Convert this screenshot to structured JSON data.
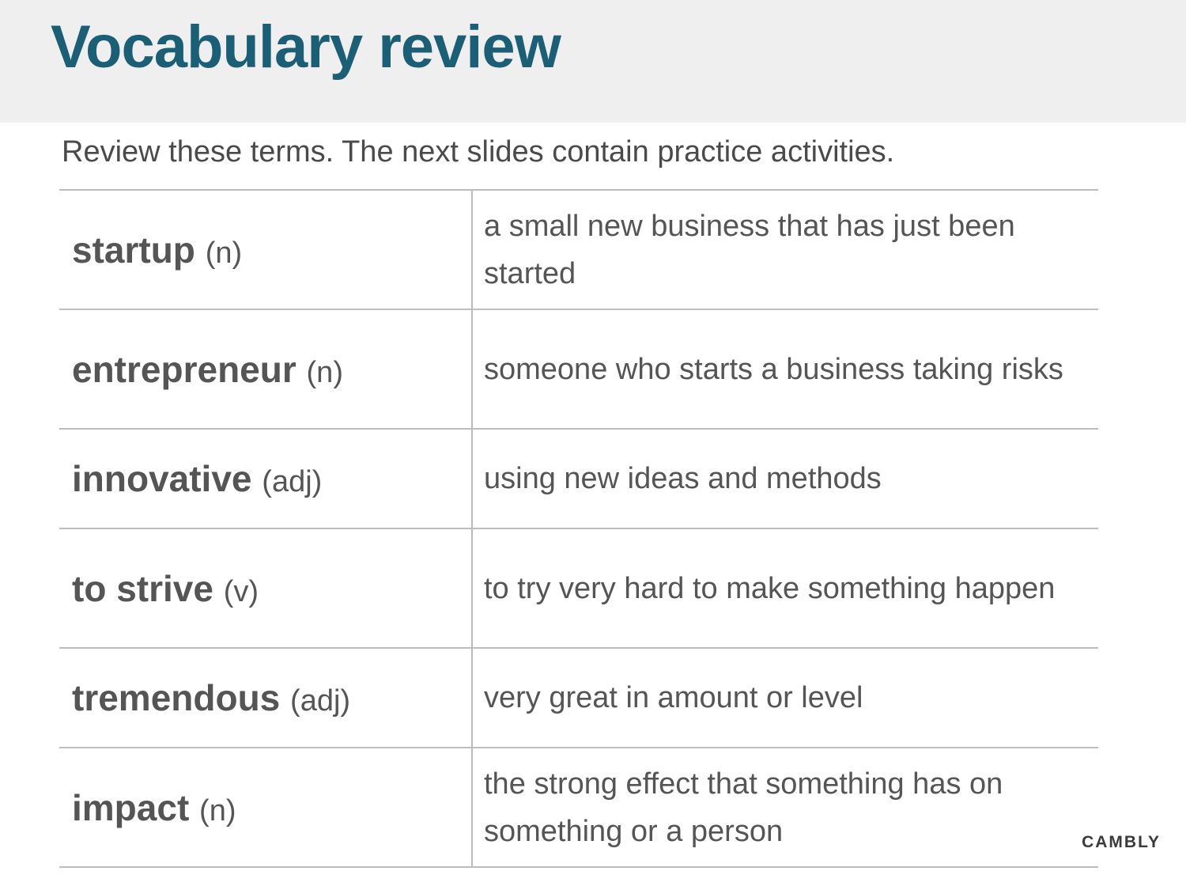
{
  "title": "Vocabulary review",
  "subtitle": "Review these terms. The next slides contain practice activities.",
  "terms": [
    {
      "word": "startup",
      "pos": "(n)",
      "definition": "a small new business that has just been started"
    },
    {
      "word": "entrepreneur",
      "pos": "(n)",
      "definition": "someone who starts a business taking risks"
    },
    {
      "word": "innovative",
      "pos": "(adj)",
      "definition": "using new ideas and methods"
    },
    {
      "word": "to strive",
      "pos": "(v)",
      "definition": "to try very hard to make something happen"
    },
    {
      "word": "tremendous",
      "pos": "(adj)",
      "definition": "very great in amount or level"
    },
    {
      "word": "impact",
      "pos": "(n)",
      "definition": "the strong effect that something has on something or a person"
    }
  ],
  "brand": "CAMBLY",
  "colors": {
    "title": "#1b5f76",
    "header_background": "#efefef",
    "body_text": "#555555",
    "rule": "#bdbdbd"
  }
}
